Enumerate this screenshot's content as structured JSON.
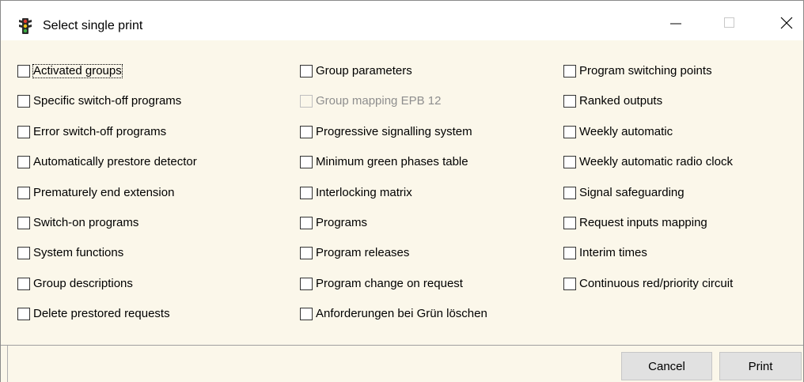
{
  "window": {
    "title": "Select single print",
    "icon": "traffic-light-icon",
    "controls": [
      "minimize-icon",
      "maximize-icon",
      "close-icon"
    ]
  },
  "options": {
    "col1": [
      {
        "label": "Activated groups",
        "checked": false,
        "enabled": true,
        "focused": true
      },
      {
        "label": "Specific switch-off programs",
        "checked": false,
        "enabled": true
      },
      {
        "label": "Error switch-off programs",
        "checked": false,
        "enabled": true
      },
      {
        "label": "Automatically prestore detector",
        "checked": false,
        "enabled": true
      },
      {
        "label": "Prematurely end extension",
        "checked": false,
        "enabled": true
      },
      {
        "label": "Switch-on programs",
        "checked": false,
        "enabled": true
      },
      {
        "label": "System functions",
        "checked": false,
        "enabled": true
      },
      {
        "label": "Group descriptions",
        "checked": false,
        "enabled": true
      },
      {
        "label": "Delete prestored requests",
        "checked": false,
        "enabled": true
      }
    ],
    "col2": [
      {
        "label": "Group parameters",
        "checked": false,
        "enabled": true
      },
      {
        "label": "Group mapping EPB 12",
        "checked": false,
        "enabled": false
      },
      {
        "label": "Progressive signalling system",
        "checked": false,
        "enabled": true
      },
      {
        "label": "Minimum green phases table",
        "checked": false,
        "enabled": true
      },
      {
        "label": "Interlocking matrix",
        "checked": false,
        "enabled": true
      },
      {
        "label": "Programs",
        "checked": false,
        "enabled": true
      },
      {
        "label": "Program releases",
        "checked": false,
        "enabled": true
      },
      {
        "label": "Program change on request",
        "checked": false,
        "enabled": true
      },
      {
        "label": "Anforderungen bei Grün löschen",
        "checked": false,
        "enabled": true
      }
    ],
    "col3": [
      {
        "label": "Program switching points",
        "checked": false,
        "enabled": true
      },
      {
        "label": "Ranked outputs",
        "checked": false,
        "enabled": true
      },
      {
        "label": "Weekly automatic",
        "checked": false,
        "enabled": true
      },
      {
        "label": "Weekly automatic radio clock",
        "checked": false,
        "enabled": true
      },
      {
        "label": "Signal safeguarding",
        "checked": false,
        "enabled": true
      },
      {
        "label": "Request inputs mapping",
        "checked": false,
        "enabled": true
      },
      {
        "label": "Interim times",
        "checked": false,
        "enabled": true
      },
      {
        "label": "Continuous red/priority circuit",
        "checked": false,
        "enabled": true
      }
    ]
  },
  "buttons": {
    "cancel": "Cancel",
    "print": "Print"
  },
  "colors": {
    "dialog_background": "#fbf7ea",
    "titlebar_background": "#ffffff",
    "button_background": "#e1e1e1",
    "disabled_text": "#8e8e8e"
  }
}
